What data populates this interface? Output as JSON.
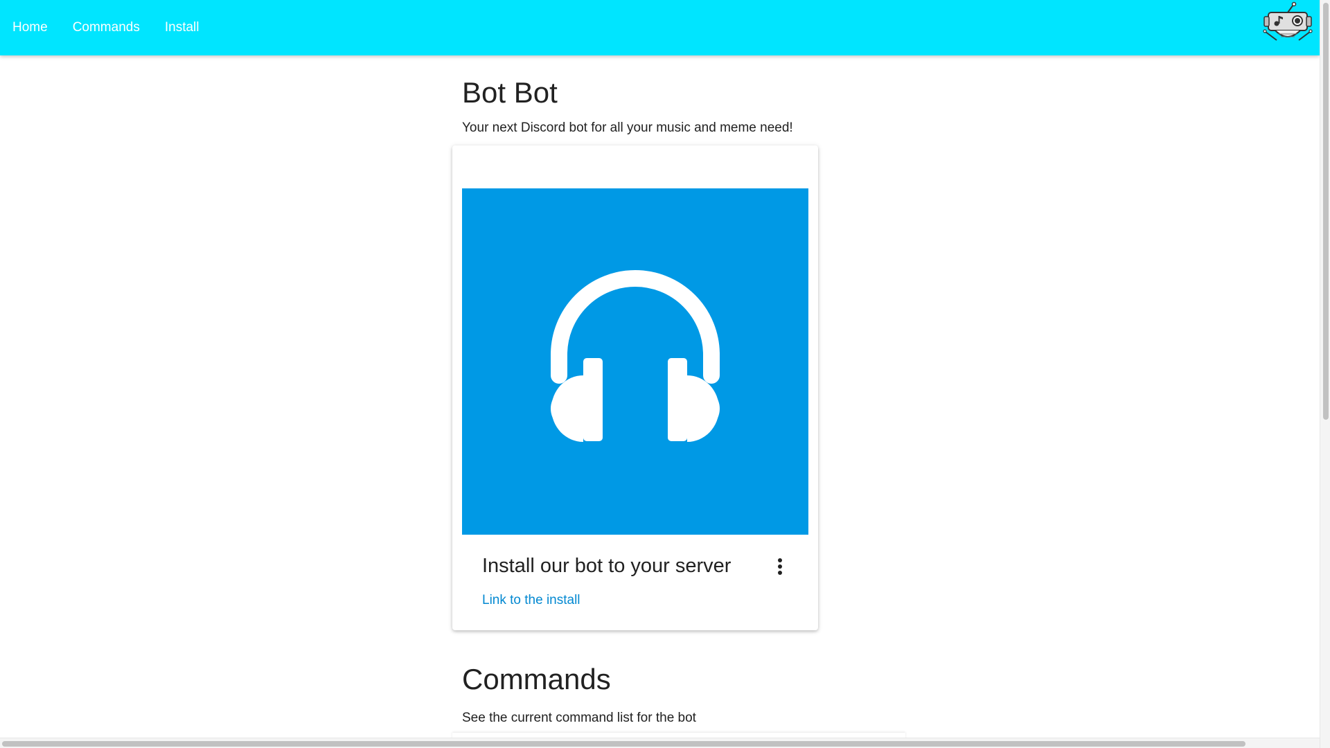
{
  "nav": {
    "items": [
      {
        "label": "Home"
      },
      {
        "label": "Commands"
      },
      {
        "label": "Install"
      }
    ],
    "background": "#00e5ff"
  },
  "hero": {
    "title": "Bot Bot",
    "subtitle": "Your next Discord bot for all your music and meme need!"
  },
  "install_card": {
    "media_icon": "headphones-icon",
    "media_color": "#0099e5",
    "title": "Install our bot to your server",
    "menu_icon": "more-vert-icon",
    "link_label": "Link to the install",
    "link_color": "#0288d1"
  },
  "commands_section": {
    "title": "Commands",
    "subtitle": "See the current command list for the bot"
  },
  "logo": {
    "icon": "robot-logo-icon"
  }
}
